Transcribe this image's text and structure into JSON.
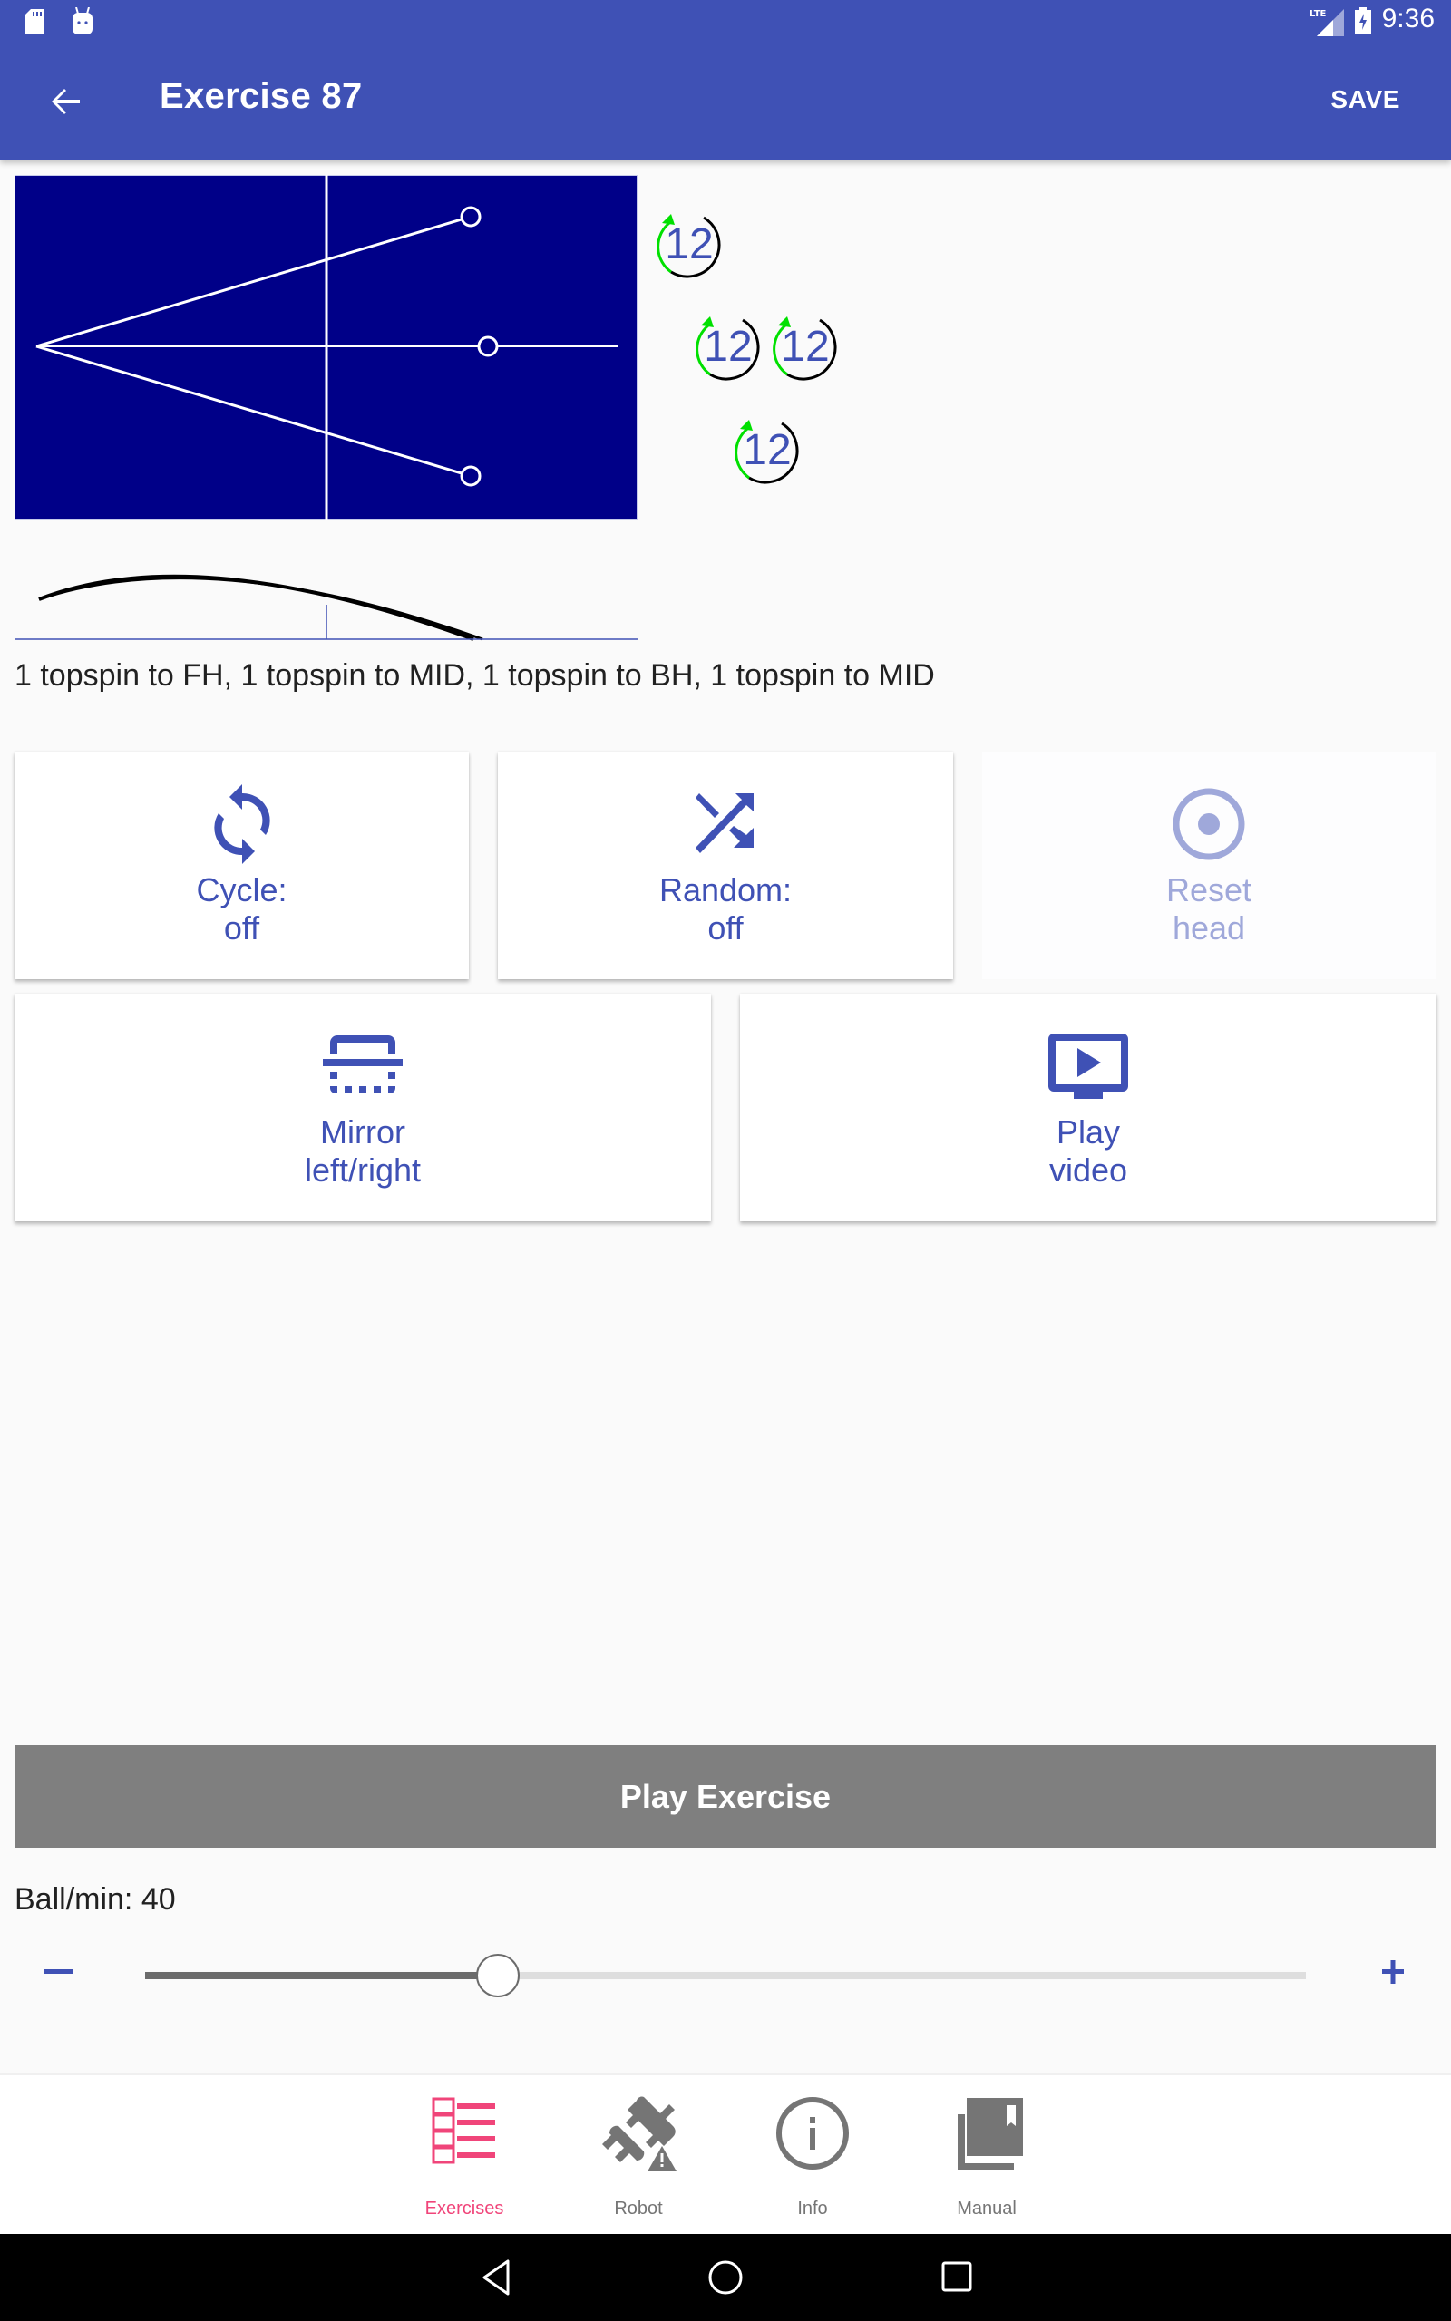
{
  "status_bar": {
    "time": "9:36",
    "network": "LTE",
    "left_icons": [
      "sd-card-icon",
      "android-debug-icon"
    ],
    "right_icons": [
      "signal-icon",
      "battery-charging-icon"
    ]
  },
  "toolbar": {
    "title": "Exercise 87",
    "save_label": "SAVE",
    "back_icon": "arrow-back-icon"
  },
  "colors": {
    "primary": "#3F51B5",
    "accent": "#F0457A",
    "table": "#000088",
    "spin_green": "#00E000",
    "disabled": "#9FA8DA",
    "play_button": "#7F7F7F"
  },
  "exercise": {
    "balls": [
      {
        "type": "topspin",
        "target": "FH",
        "spin": "12"
      },
      {
        "type": "topspin",
        "target": "MID",
        "spin": "12"
      },
      {
        "type": "topspin",
        "target": "BH",
        "spin": "12"
      },
      {
        "type": "topspin",
        "target": "MID",
        "spin": "12"
      }
    ],
    "description": "1 topspin to FH, 1 topspin to MID, 1 topspin to BH, 1 topspin to MID"
  },
  "options": {
    "cycle": {
      "line1": "Cycle:",
      "line2": "off",
      "icon": "cycle-icon"
    },
    "random": {
      "line1": "Random:",
      "line2": "off",
      "icon": "shuffle-icon"
    },
    "reset_head": {
      "line1": "Reset",
      "line2": "head",
      "icon": "radio-button-icon",
      "enabled": false
    },
    "mirror": {
      "line1": "Mirror",
      "line2": "left/right",
      "icon": "flip-icon"
    },
    "play_video": {
      "line1": "Play",
      "line2": "video",
      "icon": "video-icon"
    }
  },
  "play_exercise_label": "Play Exercise",
  "speed": {
    "label": "Ball/min: 40",
    "value": 40,
    "fraction": 0.304,
    "minus": "−",
    "plus": "+"
  },
  "bottom_nav": {
    "tabs": [
      {
        "label": "Exercises",
        "icon": "exercise-list-icon",
        "active": true
      },
      {
        "label": "Robot",
        "icon": "robot-disconnected-icon",
        "active": false
      },
      {
        "label": "Info",
        "icon": "info-icon",
        "active": false
      },
      {
        "label": "Manual",
        "icon": "manual-library-icon",
        "active": false
      }
    ]
  },
  "system_nav": [
    "back",
    "home",
    "recents"
  ]
}
